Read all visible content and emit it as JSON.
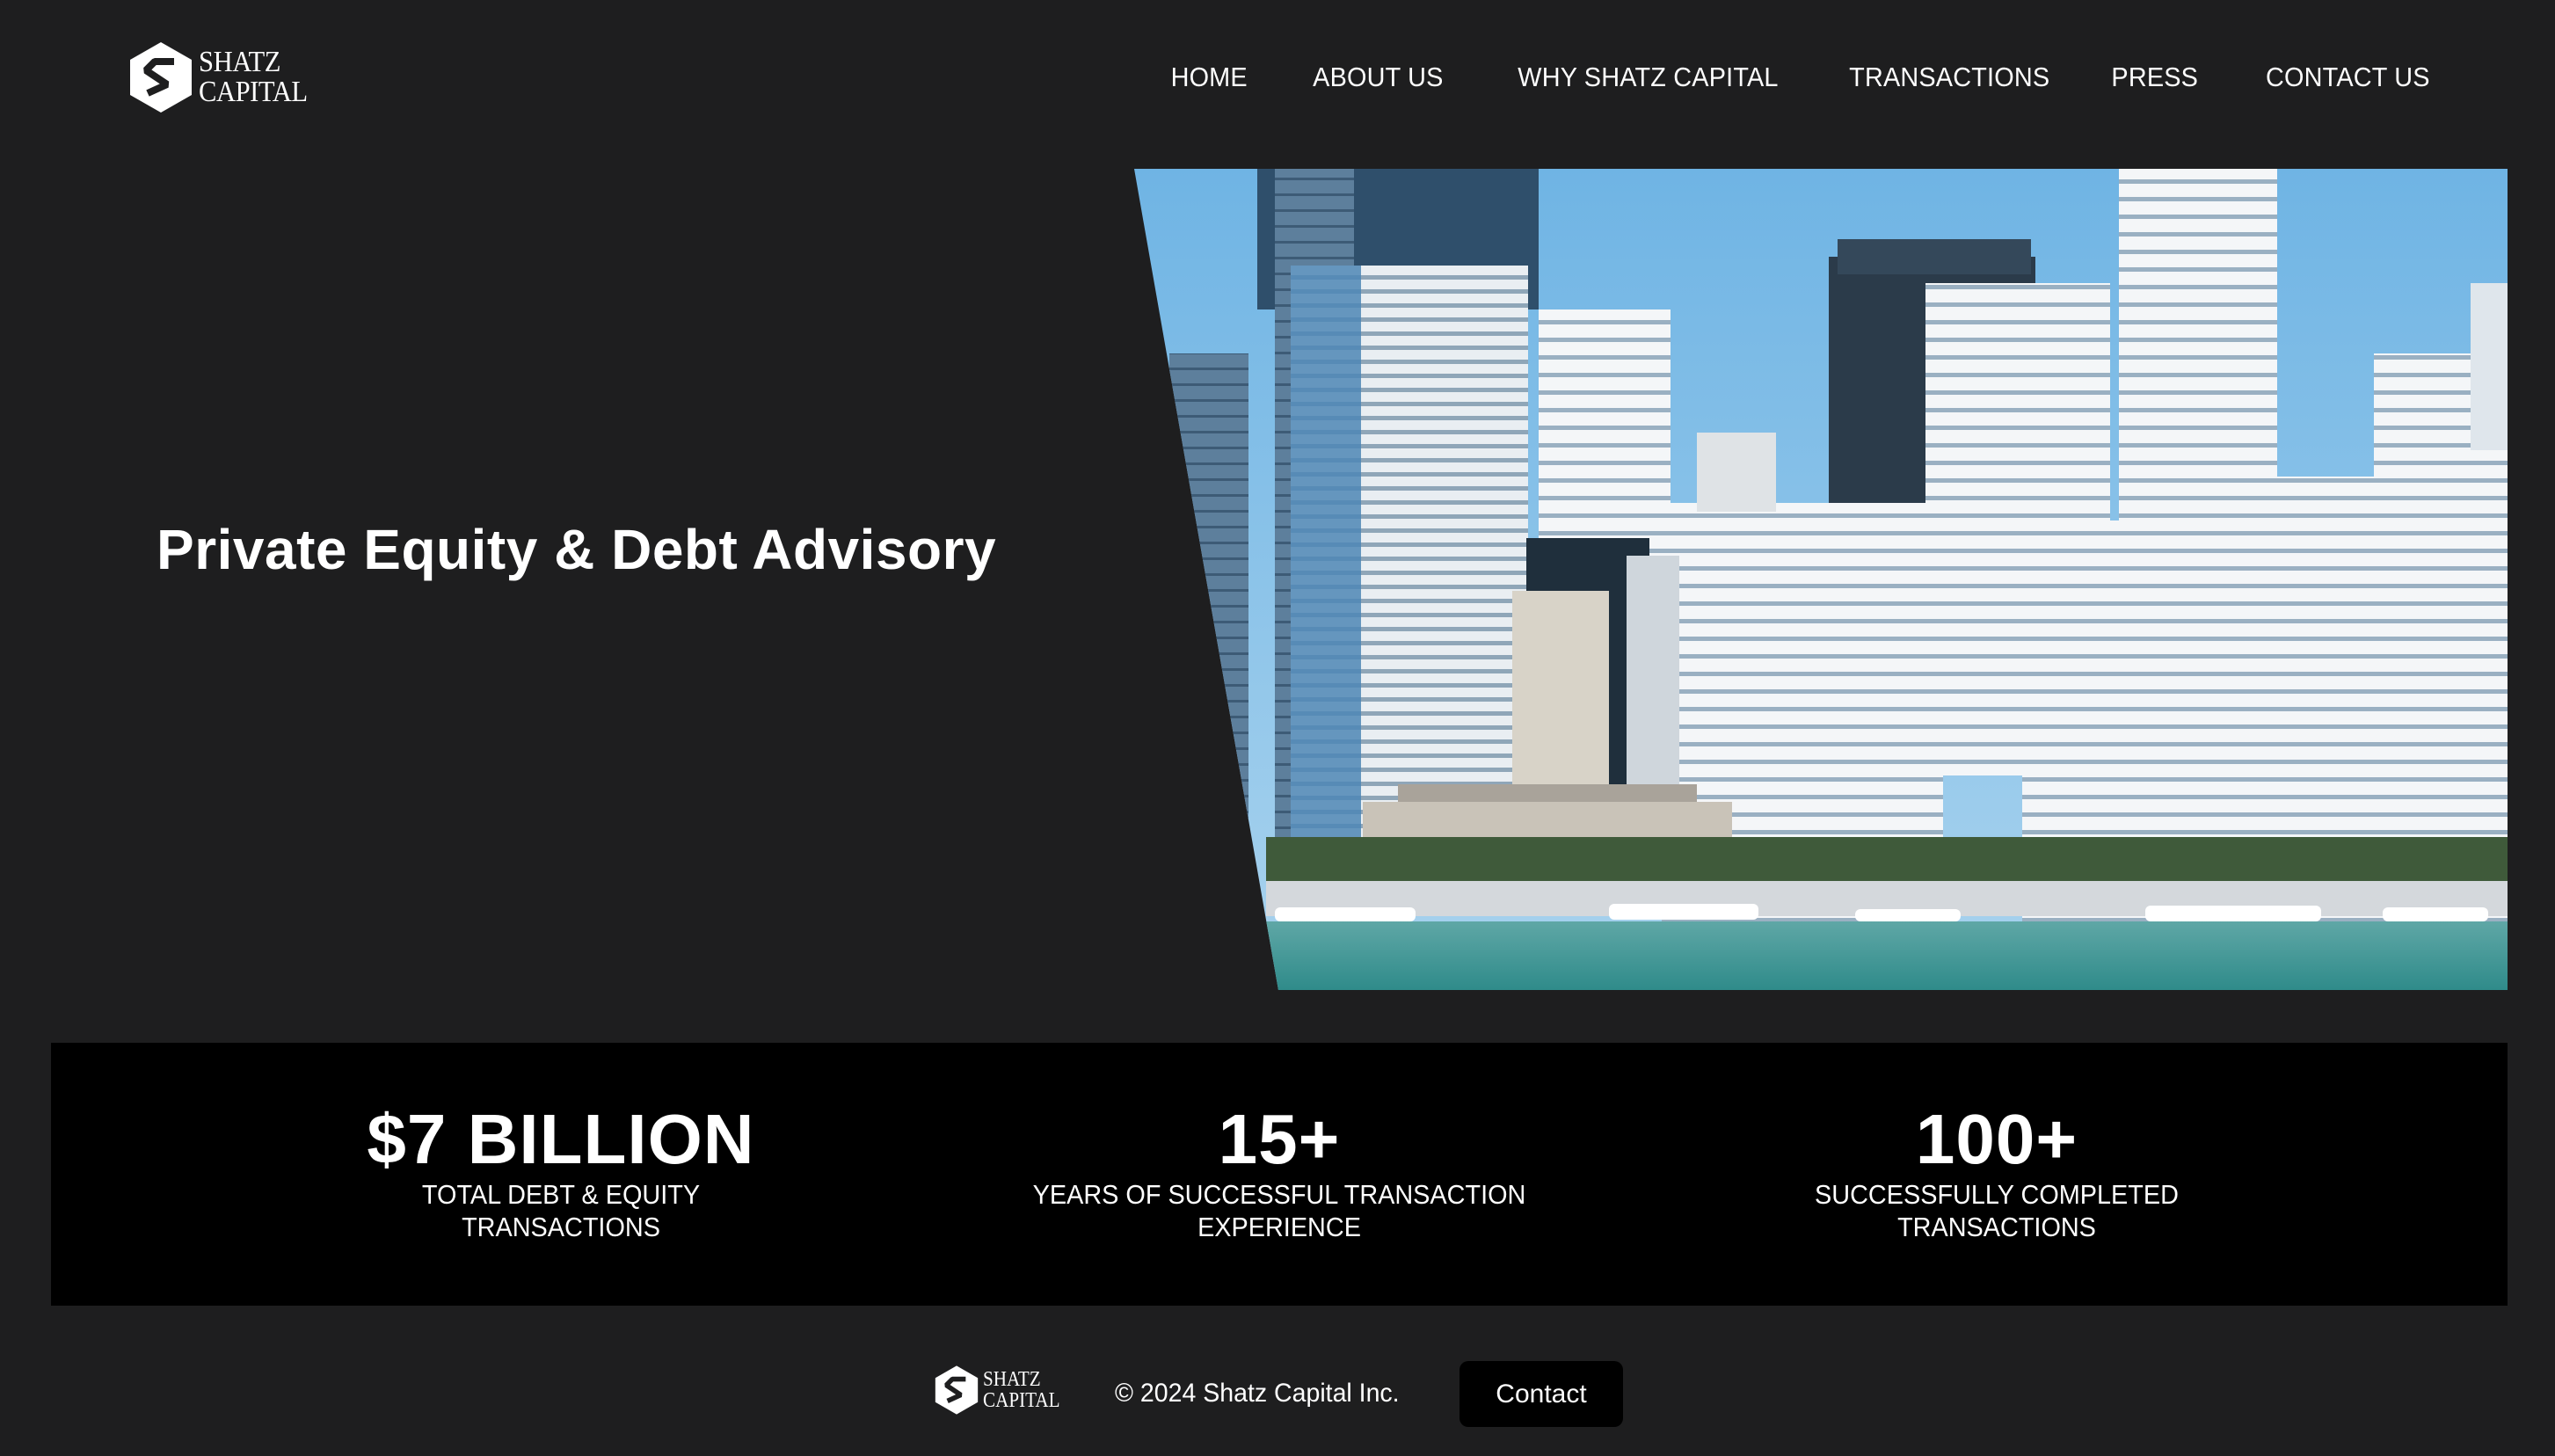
{
  "brand": {
    "logo_line1": "SHATZ",
    "logo_line2": "CAPITAL"
  },
  "nav": {
    "items": [
      "HOME",
      "ABOUT US",
      "WHY SHATZ CAPITAL",
      "TRANSACTIONS",
      "PRESS",
      "CONTACT US"
    ]
  },
  "hero": {
    "title": "Private Equity & Debt Advisory",
    "image": "miami-waterfront-skyline-photo"
  },
  "stats": [
    {
      "value": "$7 BILLION",
      "label_line1": "TOTAL DEBT & EQUITY",
      "label_line2": "TRANSACTIONS"
    },
    {
      "value": "15+",
      "label_line1": "YEARS OF SUCCESSFUL TRANSACTION",
      "label_line2": "EXPERIENCE"
    },
    {
      "value": "100+",
      "label_line1": "SUCCESSFULLY COMPLETED",
      "label_line2": "TRANSACTIONS"
    }
  ],
  "footer": {
    "copyright": "© 2024 Shatz Capital Inc.",
    "contact_label": "Contact"
  },
  "colors": {
    "page_bg": "#1e1e1f",
    "band_bg": "#000000",
    "text": "#ffffff"
  }
}
